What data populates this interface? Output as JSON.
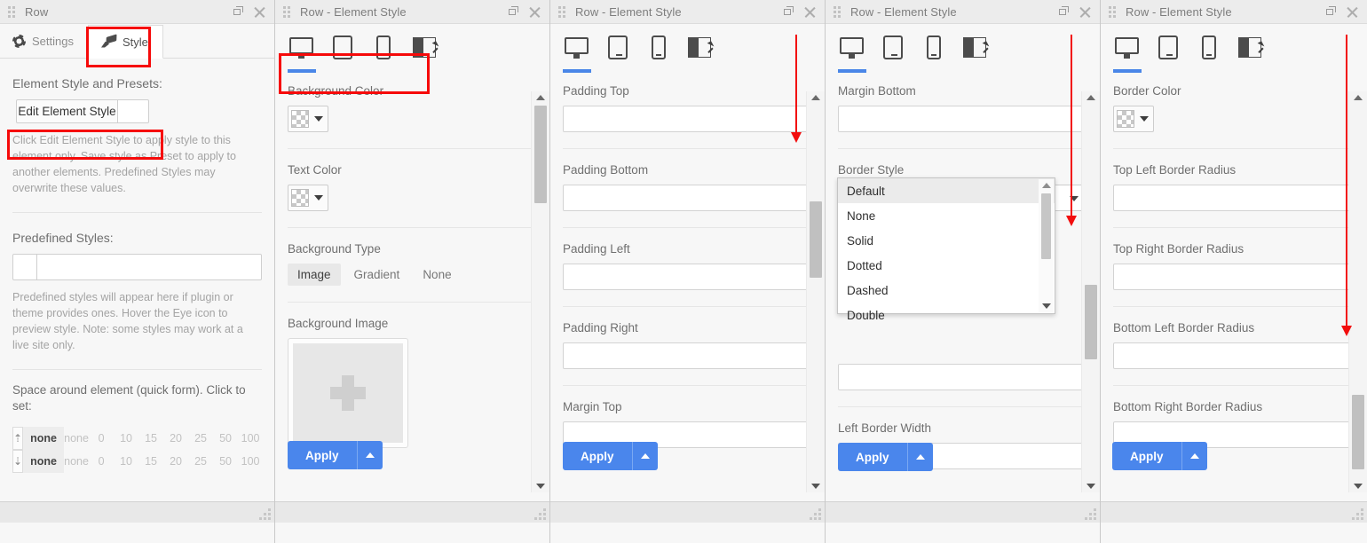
{
  "panels": [
    {
      "title": "Row",
      "tabs": [
        {
          "label": "Settings",
          "icon": "gear-icon",
          "active": false
        },
        {
          "label": "Style",
          "icon": "brush-icon",
          "active": true
        }
      ],
      "element_style_label": "Element Style and Presets:",
      "edit_element_style_button": "Edit Element Style",
      "edit_help": "Click Edit Element Style to apply style to this element only. Save style as Preset to apply to another elements. Predefined Styles may overwrite these values.",
      "predefined_label": "Predefined Styles:",
      "predefined_value": "",
      "predefined_help": "Predefined styles will appear here if plugin or theme provides ones. Hover the Eye icon to preview style. Note: some styles may work at a live site only.",
      "space_label": "Space around element (quick form). Click to set:",
      "space_rows": [
        {
          "icon": "arrow-up-to-line-icon",
          "current": "none",
          "options": [
            "none",
            "0",
            "10",
            "15",
            "20",
            "25",
            "50",
            "100"
          ]
        },
        {
          "icon": "arrow-down-to-line-icon",
          "current": "none",
          "options": [
            "none",
            "0",
            "10",
            "15",
            "20",
            "25",
            "50",
            "100"
          ]
        }
      ]
    },
    {
      "title": "Row - Element Style",
      "devices": [
        "desktop-icon",
        "tablet-icon",
        "phone-icon",
        "hover-state-icon"
      ],
      "active_device": 0,
      "fields": [
        {
          "type": "color",
          "label": "Background Color",
          "value": ""
        },
        {
          "type": "color",
          "label": "Text Color",
          "value": ""
        },
        {
          "type": "segmented",
          "label": "Background Type",
          "options": [
            "Image",
            "Gradient",
            "None"
          ],
          "selected": "Image"
        },
        {
          "type": "image",
          "label": "Background Image",
          "value": ""
        }
      ],
      "apply_label": "Apply"
    },
    {
      "title": "Row - Element Style",
      "devices": [
        "desktop-icon",
        "tablet-icon",
        "phone-icon",
        "hover-state-icon"
      ],
      "active_device": 0,
      "fields": [
        {
          "type": "text",
          "label": "Padding Top",
          "value": ""
        },
        {
          "type": "text",
          "label": "Padding Bottom",
          "value": ""
        },
        {
          "type": "text",
          "label": "Padding Left",
          "value": ""
        },
        {
          "type": "text",
          "label": "Padding Right",
          "value": ""
        },
        {
          "type": "text",
          "label": "Margin Top",
          "value": ""
        }
      ],
      "apply_label": "Apply"
    },
    {
      "title": "Row - Element Style",
      "devices": [
        "desktop-icon",
        "tablet-icon",
        "phone-icon",
        "hover-state-icon"
      ],
      "active_device": 0,
      "fields": [
        {
          "type": "text",
          "label": "Margin Bottom",
          "value": ""
        },
        {
          "type": "select",
          "label": "Border Style",
          "value": "Default",
          "options": [
            "Default",
            "None",
            "Solid",
            "Dotted",
            "Dashed",
            "Double"
          ],
          "open": true,
          "selected": "Default"
        },
        {
          "type": "text",
          "label": "Left Border Width",
          "value": ""
        }
      ],
      "apply_label": "Apply"
    },
    {
      "title": "Row - Element Style",
      "devices": [
        "desktop-icon",
        "tablet-icon",
        "phone-icon",
        "hover-state-icon"
      ],
      "active_device": 0,
      "fields": [
        {
          "type": "color",
          "label": "Border Color",
          "value": ""
        },
        {
          "type": "text",
          "label": "Top Left Border Radius",
          "value": ""
        },
        {
          "type": "text",
          "label": "Top Right Border Radius",
          "value": ""
        },
        {
          "type": "text",
          "label": "Bottom Left Border Radius",
          "value": ""
        },
        {
          "type": "text",
          "label": "Bottom Right Border Radius",
          "value": ""
        }
      ],
      "apply_label": "Apply"
    }
  ],
  "annotations": {
    "accent_red": "#f20d0d",
    "accent_blue": "#4a86ec",
    "highlights": [
      "style-tab",
      "edit-element-style-button",
      "device-tab-bar"
    ],
    "arrows": [
      "scroll-down-panel3",
      "scroll-down-panel4",
      "scroll-down-panel5"
    ]
  }
}
